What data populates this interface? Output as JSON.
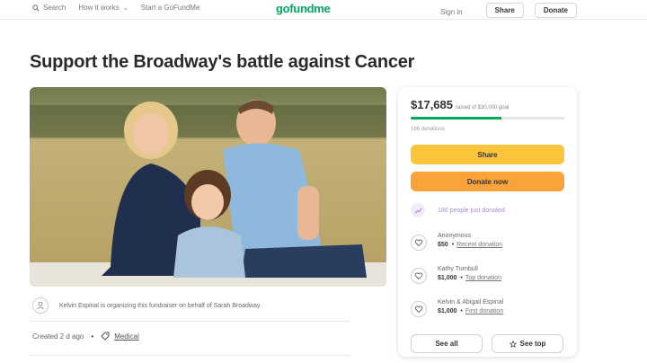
{
  "colors": {
    "brand_green": "#02a95c",
    "share_button": "#fbc53b",
    "donate_button": "#f9a33a",
    "recent_purple": "#a58ad6"
  },
  "header": {
    "search_label": "Search",
    "how_it_works_label": "How it works",
    "start_label": "Start a GoFundMe",
    "logo_text": "gofundme",
    "signin_label": "Sign in",
    "share_label": "Share",
    "donate_label": "Donate"
  },
  "campaign": {
    "title": "Support the Broadway's battle against Cancer",
    "organizer_text": "Kelvin Espinal is organizing this fundraiser on behalf of Sarah Broadway.",
    "created_text": "Created 2 d ago",
    "category": "Medical"
  },
  "sidebar": {
    "raised_amount": "$17,685",
    "goal_text": "raised of $30,000 goal",
    "progress_fraction": 0.59,
    "donations_count": "186 donations",
    "share_button": "Share",
    "donate_button": "Donate now",
    "recent_text": "186 people just donated",
    "donors": [
      {
        "name": "Anonymous",
        "amount": "$50",
        "tag": "Recent donation"
      },
      {
        "name": "Kathy Turnbull",
        "amount": "$1,000",
        "tag": "Top donation"
      },
      {
        "name": "Kelvin & Abigail Espinal",
        "amount": "$1,000",
        "tag": "First donation"
      }
    ],
    "see_all": "See all",
    "see_top": "See top"
  },
  "icons": {
    "search": "search-icon",
    "trend": "trend-up-icon",
    "donor": "donor-heart-icon",
    "tag": "tag-icon",
    "star": "star-icon",
    "user": "user-icon"
  }
}
